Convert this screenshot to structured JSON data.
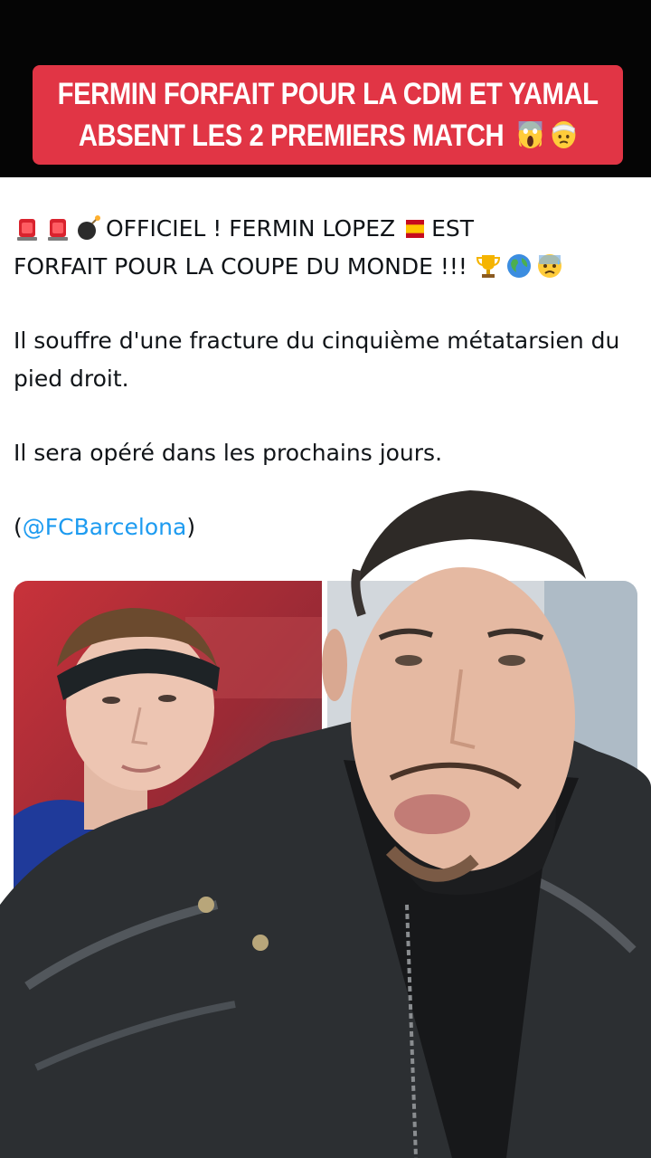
{
  "overlay": {
    "headline_line1": "FERMIN FORFAIT POUR LA CDM ET YAMAL",
    "headline_line2": "ABSENT LES 2 PREMIERS MATCH",
    "headline_emojis": [
      "screaming-face-emoji",
      "head-bandage-emoji"
    ],
    "banner_color": "#e13545"
  },
  "tweet": {
    "line1_text": "OFFICIEL ! FERMIN LOPEZ",
    "line1_after_flag": "EST",
    "line2_text": "FORFAIT POUR LA COUPE DU MONDE !!!",
    "line1_icons": [
      "siren-icon",
      "siren-icon",
      "bomb-icon",
      "spain-flag-icon"
    ],
    "line2_icons": [
      "trophy-icon",
      "globe-icon",
      "anxious-face-icon"
    ],
    "paragraph2": "Il souffre d'une fracture du cinquième métatarsien du pied droit.",
    "paragraph3": "Il sera opéré dans les prochains jours.",
    "source_open": "(",
    "source_mention": "@FCBarcelona",
    "source_close": ")",
    "mention_color": "#1d9bf0"
  },
  "media": {
    "left_image": "player-photo",
    "right_image": "photo-background"
  }
}
